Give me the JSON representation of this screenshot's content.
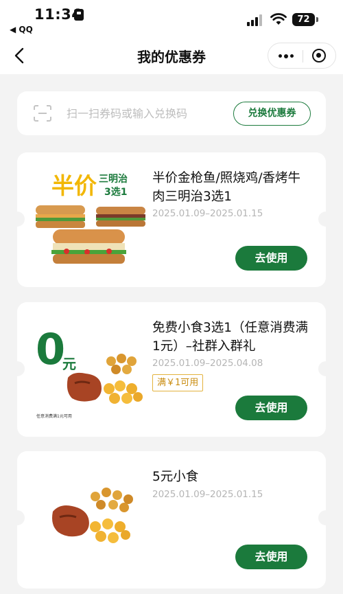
{
  "status_bar": {
    "time": "11:34",
    "back_app": "◀ QQ",
    "battery": "72"
  },
  "nav": {
    "title": "我的优惠券"
  },
  "redeem": {
    "placeholder": "扫一扫券码或输入兑换码",
    "button": "兑换优惠券"
  },
  "coupons": [
    {
      "title": "半价金枪鱼/照烧鸡/香烤牛肉三明治3选1",
      "date": "2025.01.09–2025.01.15",
      "button": "去使用",
      "image": {
        "big_text": "半价",
        "side_text_1": "三明治",
        "side_text_2": "3选1"
      }
    },
    {
      "title": "免费小食3选1（任意消费满1元）–社群入群礼",
      "date": "2025.01.09–2025.04.08",
      "tag": "满￥1可用",
      "button": "去使用",
      "image": {
        "big_text": "0",
        "unit": "元",
        "note": "任意消费满1元可用"
      }
    },
    {
      "title": "5元小食",
      "date": "2025.01.09–2025.01.15",
      "button": "去使用"
    }
  ],
  "colors": {
    "brand_green": "#1b7a3c",
    "promo_yellow": "#f2b705",
    "tag_orange": "#c98c10"
  }
}
